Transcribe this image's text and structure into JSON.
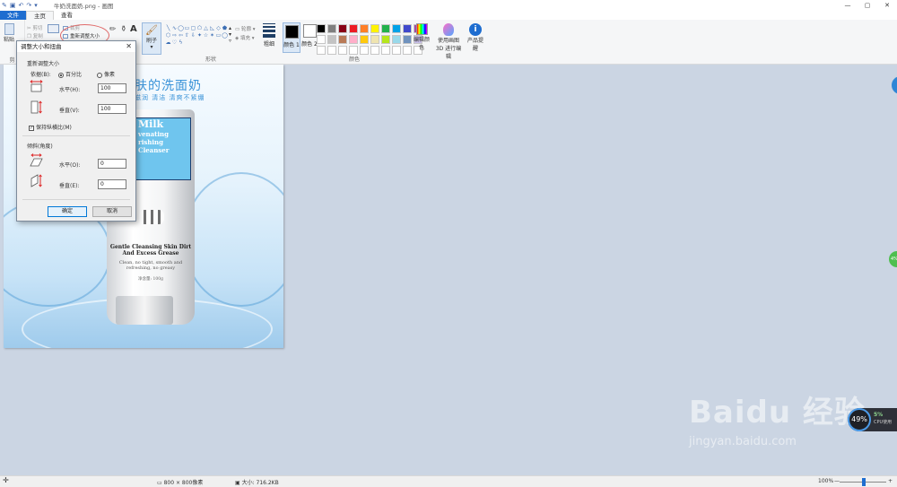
{
  "window": {
    "title": "牛奶洗面奶.png - 画图",
    "controls": [
      "—",
      "▢",
      "✕"
    ]
  },
  "tabs": [
    "文件",
    "主页",
    "查看"
  ],
  "ribbon": {
    "clipboard": {
      "paste": "粘贴",
      "cut": "剪切",
      "copy": "复制",
      "group": "剪"
    },
    "image": {
      "crop": "裁剪",
      "resize": "重新调整大小"
    },
    "brush": "刷子",
    "shapes": {
      "group": "形状",
      "outline": "轮廓",
      "fill": "填充"
    },
    "size": "粗细",
    "color1": "颜色 1",
    "color2": "颜色 2",
    "colors_group": "颜色",
    "edit_colors": "编辑颜色",
    "paint3d": "使用画图 3D 进行编辑",
    "product_alert": "产品提醒"
  },
  "palette": [
    "#000000",
    "#7f7f7f",
    "#880015",
    "#ed1c24",
    "#ff7f27",
    "#fff200",
    "#22b14c",
    "#00a2e8",
    "#3f48cc",
    "#a349a4",
    "#ffffff",
    "#c3c3c3",
    "#b97a57",
    "#ffaec9",
    "#ffc90e",
    "#efe4b0",
    "#b5e61d",
    "#99d9ea",
    "#7092be",
    "#c8bfe7",
    "#ffffff",
    "#ffffff",
    "#ffffff",
    "#ffffff",
    "#ffffff",
    "#ffffff",
    "#ffffff",
    "#ffffff",
    "#ffffff",
    "#ffffff"
  ],
  "image": {
    "headline": "肤的洗面奶",
    "subline": "滋润 清洁 清爽不紧绷",
    "label_lines": [
      "Milk",
      "venating",
      "rishing",
      "Cleanser"
    ],
    "product_name": "Gentle Cleansing Skin Dirt And Excess Grease",
    "product_desc": "Clean, no tight, smooth and refreshing, no greasy",
    "net_content": "净含量: 100g"
  },
  "dialog": {
    "title": "调整大小和扭曲",
    "resize_section": "重新调整大小",
    "by_label": "依据(B):",
    "percent": "百分比",
    "pixels": "像素",
    "horizontal": "水平(H):",
    "horizontal_value": "100",
    "vertical": "垂直(V):",
    "vertical_value": "100",
    "keep_ratio": "保持纵横比(M)",
    "skew_section": "倾斜(角度)",
    "skew_horizontal": "水平(O):",
    "skew_horizontal_value": "0",
    "skew_vertical": "垂直(E):",
    "skew_vertical_value": "0",
    "ok": "确定",
    "cancel": "取消"
  },
  "status": {
    "dimensions": "800 × 800像素",
    "size": "大小: 716.2KB",
    "zoom": "100%",
    "zoom_out": "—",
    "zoom_in": "+"
  },
  "cpu": {
    "percent": "49%",
    "usage": "5%",
    "label": "CPU使用"
  },
  "watermark": {
    "main": "Baidu 经验",
    "sub": "jingyan.baidu.com"
  },
  "side_green": "4%"
}
